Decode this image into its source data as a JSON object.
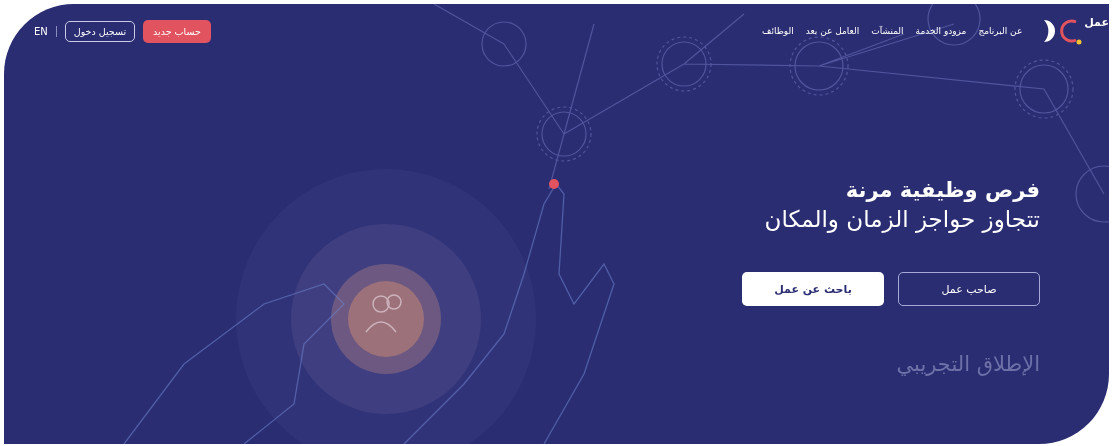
{
  "header": {
    "logo_text": "عمل",
    "nav": [
      {
        "label": "عن البرنامج"
      },
      {
        "label": "مزودو الخدمة"
      },
      {
        "label": "المنشآت"
      },
      {
        "label": "العامل عن بعد"
      },
      {
        "label": "الوظائف"
      }
    ],
    "language": "EN",
    "login": "تسجيل دخول",
    "register": "حساب جديد"
  },
  "hero": {
    "title": "فرص وظيفية مرنة",
    "subtitle": "تتجاوز حواجز الزمان والمكان",
    "buttons": [
      {
        "label": "صاحب عمل",
        "kind": "outline"
      },
      {
        "label": "باحث عن عمل",
        "kind": "solid"
      }
    ],
    "tagline": "الإطلاق التجريبي"
  }
}
